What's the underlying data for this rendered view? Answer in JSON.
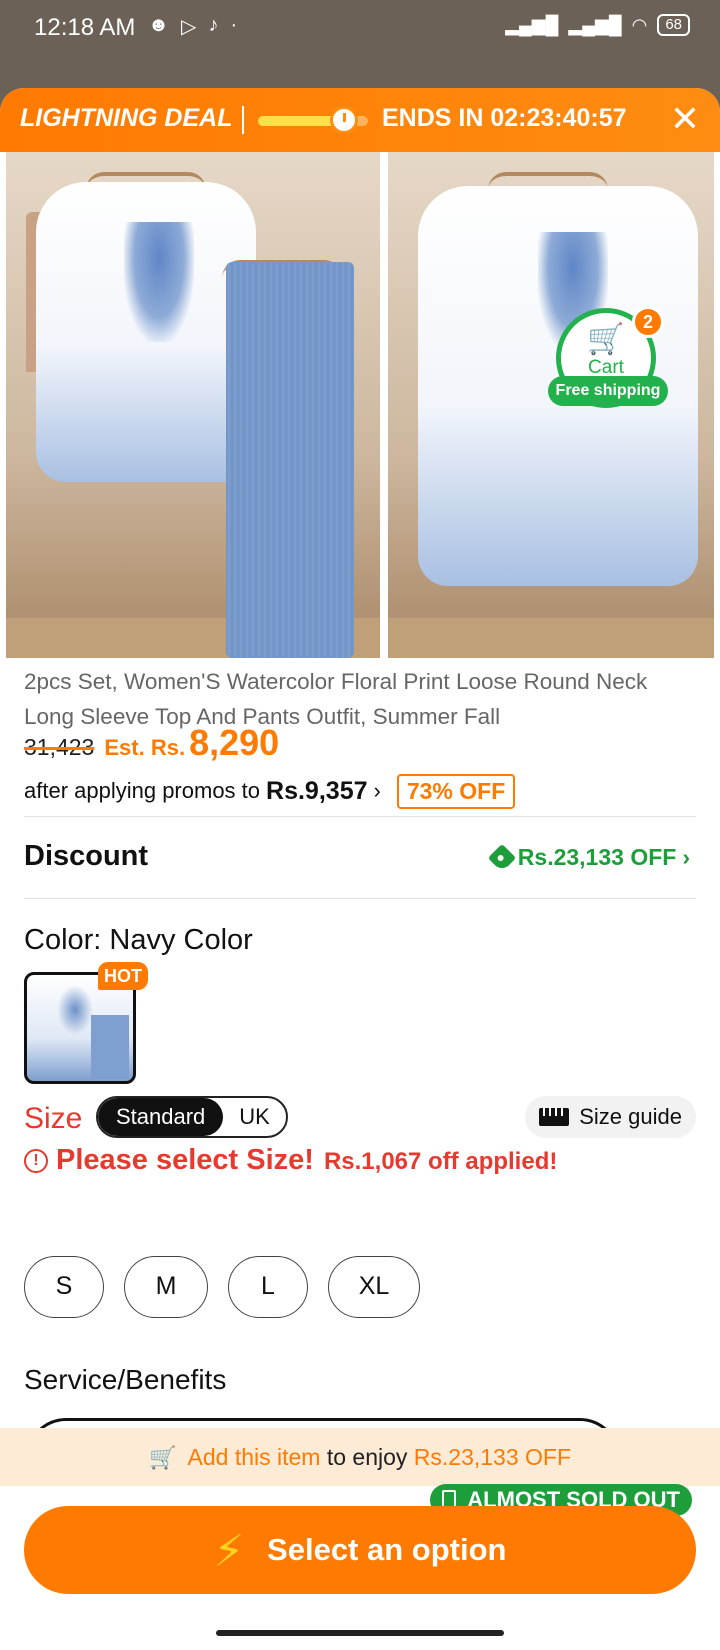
{
  "status": {
    "time": "12:18 AM",
    "notif_icons": [
      "ghost-icon",
      "play-icon",
      "tiktok-icon",
      "dot-icon"
    ],
    "battery": "68"
  },
  "deal": {
    "title": "LIGHTNING DEAL",
    "ends_label": "ENDS IN 02:23:40:57",
    "progress": 0.8,
    "close": "✕"
  },
  "cart": {
    "label": "Cart",
    "count": "2",
    "shipping": "Free shipping"
  },
  "product": {
    "title": "2pcs Set, Women'S Watercolor Floral Print Loose Round Neck Long Sleeve Top And Pants Outfit, Summer Fall",
    "old_price": "31,423",
    "est_label": "Est. Rs.",
    "price": "8,290",
    "promo_text": "after applying promos to",
    "promo_price": "Rs.9,357",
    "off_badge": "73% OFF"
  },
  "discount": {
    "label": "Discount",
    "value": "Rs.23,133 OFF"
  },
  "color": {
    "label": "Color: Navy Color",
    "hot": "HOT"
  },
  "size": {
    "label": "Size",
    "standards": [
      "Standard",
      "UK"
    ],
    "guide": "Size guide",
    "warning": "Please select Size!",
    "applied": "Rs.1,067 off applied!",
    "options": [
      "S",
      "M",
      "L",
      "XL"
    ]
  },
  "service": {
    "title": "Service/Benefits"
  },
  "bottom": {
    "add_prefix": "Add this item",
    "add_middle": "to enjoy",
    "add_amount": "Rs.23,133 OFF",
    "sold_out": "ALMOST SOLD OUT",
    "cta": "Select an option"
  }
}
